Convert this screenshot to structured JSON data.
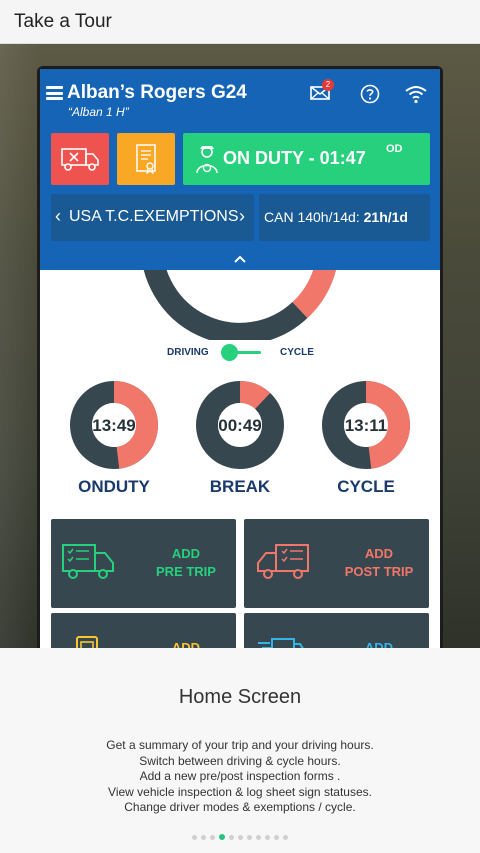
{
  "tour": {
    "title": "Take a Tour",
    "heading": "Home Screen",
    "description": [
      "Get a summary of your trip and your driving hours.",
      "Switch between driving & cycle hours.",
      "Add a new pre/post inspection forms .",
      "View vehicle inspection & log sheet sign statuses.",
      "Change driver modes & exemptions / cycle."
    ],
    "pages": 11,
    "current_page": 3
  },
  "app": {
    "vehicle": "Alban’s Rogers G24",
    "driver": "“Alban 1 H”",
    "message_count": "2",
    "status": {
      "label": "ON DUTY - 01:47",
      "code": "OD"
    },
    "exemption": "USA T.C.EXEMPTIONS",
    "cycle": {
      "prefix": "CAN 140h/14d: ",
      "value": "21h/1d"
    },
    "toggle": {
      "left": "DRIVING",
      "right": "CYCLE"
    },
    "gauges": [
      {
        "time": "13:49",
        "label": "ONDUTY",
        "fraction": 0.48
      },
      {
        "time": "00:49",
        "label": "BREAK",
        "fraction": 0.12
      },
      {
        "time": "13:11",
        "label": "CYCLE",
        "fraction": 0.48
      }
    ],
    "actions": [
      {
        "line1": "ADD",
        "line2": "PRE TRIP",
        "color": "#26d07c"
      },
      {
        "line1": "ADD",
        "line2": "POST TRIP",
        "color": "#f0776a"
      },
      {
        "line1": "ADD",
        "line2": "",
        "color": "#f9c531"
      },
      {
        "line1": "ADD",
        "line2": "",
        "color": "#33b5e5"
      }
    ]
  },
  "colors": {
    "header": "#1564b5",
    "gauge_dark": "#37474f",
    "gauge_accent": "#f0776a",
    "text_dark": "#1a3a6b",
    "duty_green": "#26d07c"
  }
}
